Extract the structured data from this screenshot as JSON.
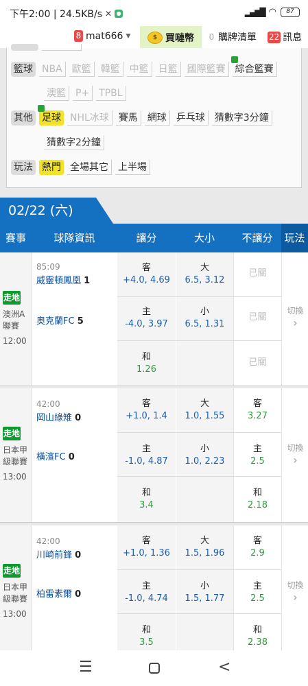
{
  "status_bar": {
    "time_speed": "下午2:00 | 24.5KB/s",
    "battery": "87"
  },
  "top_nav": {
    "user_badge": "8",
    "username": "mat666",
    "buy_coins": "買嗹幣",
    "cart_badge": "0",
    "cart_label": "購牌清單",
    "msg_badge": "22",
    "msg_label": "訊息"
  },
  "filter": {
    "basketball": {
      "category": "籃球",
      "options": [
        "NBA",
        "歐籃",
        "韓籃",
        "中籃",
        "日籃",
        "國際籃賽",
        "綜合籃賽",
        "澳籃",
        "P+",
        "TPBL"
      ]
    },
    "other": {
      "category": "其他",
      "options": [
        "足球",
        "NHL冰球",
        "賽馬",
        "網球",
        "乒乓球",
        "猜數字3分鐘",
        "猜數字2分鐘"
      ]
    },
    "play": {
      "category": "玩法",
      "options": [
        "熱門",
        "全場其它",
        "上半場"
      ]
    }
  },
  "date_tab": "02/22 (六)",
  "table_header": {
    "event": "賽事",
    "team_info": "球隊資訊",
    "handicap": "讓分",
    "over_under": "大小",
    "no_handicap": "不讓分",
    "play": "玩法"
  },
  "matches": [
    {
      "live": "走地",
      "league": "澳洲A聯賽",
      "kickoff": "12:00",
      "elapsed": "85:09",
      "away_team": "威靈頓鳳凰",
      "away_score": "1",
      "home_team": "奧克蘭FC",
      "home_score": "5",
      "hcp_away_label": "客",
      "hcp_away_odds": "+4.0, 4.69",
      "hcp_home_label": "主",
      "hcp_home_odds": "-4.0, 3.97",
      "hcp_draw_label": "和",
      "hcp_draw_odds": "1.26",
      "ou_over_label": "大",
      "ou_over_odds": "6.5, 3.12",
      "ou_under_label": "小",
      "ou_under_odds": "6.5, 1.31",
      "nh_1": "已關",
      "nh_2": "已關",
      "nh_3": "已關",
      "switch": "切換",
      "switch_arrow": "›"
    },
    {
      "live": "走地",
      "league": "日本甲級聯賽",
      "kickoff": "13:00",
      "elapsed": "42:00",
      "away_team": "岡山綠雉",
      "away_score": "0",
      "home_team": "橫濱FC",
      "home_score": "0",
      "hcp_away_label": "客",
      "hcp_away_odds": "+1.0, 1.4",
      "hcp_home_label": "主",
      "hcp_home_odds": "-1.0, 4.87",
      "hcp_draw_label": "和",
      "hcp_draw_odds": "3.4",
      "ou_over_label": "大",
      "ou_over_odds": "1.0, 1.55",
      "ou_under_label": "小",
      "ou_under_odds": "1.0, 2.23",
      "nh_away_label": "客",
      "nh_away_odds": "3.27",
      "nh_home_label": "主",
      "nh_home_odds": "2.5",
      "nh_draw_label": "和",
      "nh_draw_odds": "2.18",
      "switch": "切換",
      "switch_arrow": "›"
    },
    {
      "live": "走地",
      "league": "日本甲級聯賽",
      "kickoff": "13:00",
      "elapsed": "42:00",
      "away_team": "川崎前鋒",
      "away_score": "0",
      "home_team": "柏雷素爾",
      "home_score": "0",
      "hcp_away_label": "客",
      "hcp_away_odds": "+1.0, 1.36",
      "hcp_home_label": "主",
      "hcp_home_odds": "-1.0, 4.74",
      "hcp_draw_label": "和",
      "hcp_draw_odds": "3.5",
      "ou_over_label": "大",
      "ou_over_odds": "1.5, 1.96",
      "ou_under_label": "小",
      "ou_under_odds": "1.5, 1.77",
      "nh_away_label": "客",
      "nh_away_odds": "2.9",
      "nh_home_label": "主",
      "nh_home_odds": "2.5",
      "nh_draw_label": "和",
      "nh_draw_odds": "2.38",
      "switch": "切換",
      "switch_arrow": "›"
    }
  ],
  "bottom_nav": {
    "menu": "☰",
    "back": "<"
  }
}
